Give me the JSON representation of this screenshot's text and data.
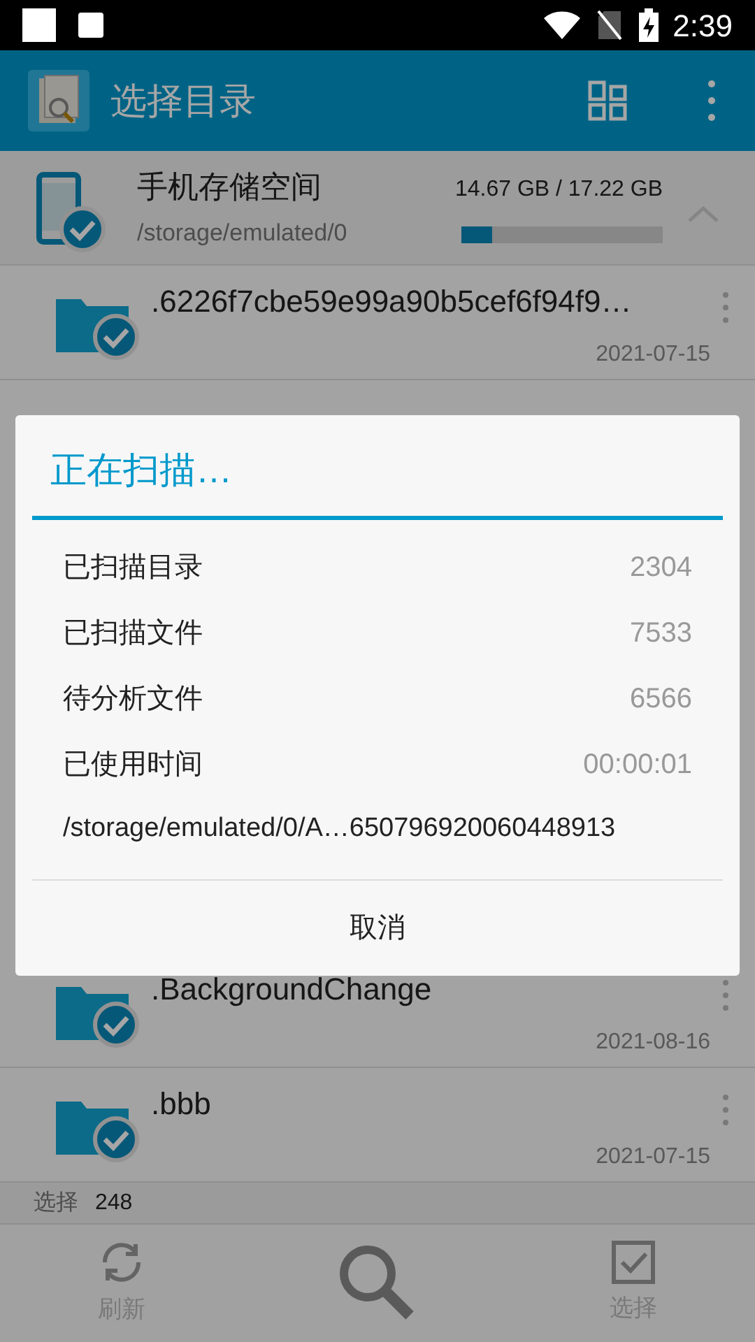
{
  "status_bar": {
    "time": "2:39"
  },
  "app_bar": {
    "title": "选择目录"
  },
  "storage": {
    "name": "手机存储空间",
    "path": "/storage/emulated/0",
    "usage": "14.67 GB / 17.22 GB",
    "level": 0.15,
    "expanded": true
  },
  "folders_top": [
    {
      "name": ".6226f7cbe59e99a90b5cef6f94f9…",
      "date": "2021-07-15",
      "checked": true
    }
  ],
  "folders_bottom": [
    {
      "name": ".BackgroundChange",
      "date": "2021-08-16",
      "checked": true
    },
    {
      "name": ".bbb",
      "date": "2021-07-15",
      "checked": true
    }
  ],
  "selection": {
    "label": "选择",
    "count": "248"
  },
  "bottom_bar": [
    {
      "kind": "refresh",
      "label": "刷新"
    },
    {
      "kind": "search"
    },
    {
      "kind": "select",
      "label": "选择"
    }
  ],
  "dialog": {
    "title": "正在扫描…",
    "stats": [
      {
        "label": "已扫描目录",
        "value": "2304"
      },
      {
        "label": "已扫描文件",
        "value": "7533"
      },
      {
        "label": "待分析文件",
        "value": "6566"
      },
      {
        "label": "已使用时间",
        "value": "00:00:01"
      }
    ],
    "path": "/storage/emulated/0/A…650796920060448913",
    "button": "取消"
  }
}
